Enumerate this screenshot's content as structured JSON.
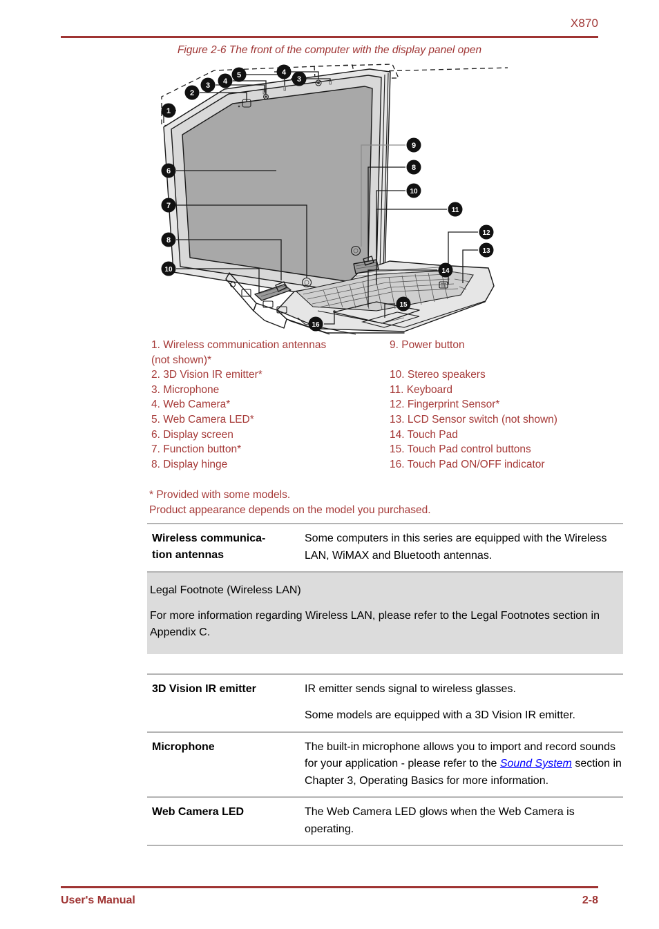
{
  "header": {
    "title": "X870"
  },
  "figure": {
    "caption": "Figure 2-6 The front of the computer with the display panel open",
    "callouts": [
      "1",
      "2",
      "3",
      "4",
      "5",
      "6",
      "7",
      "8",
      "9",
      "10",
      "11",
      "12",
      "13",
      "14",
      "15",
      "16"
    ]
  },
  "legend": {
    "left": [
      "1. Wireless communication antennas\n(not shown)*",
      "2. 3D Vision IR emitter*",
      "3. Microphone",
      "4. Web Camera*",
      "5. Web Camera LED*",
      "6. Display screen",
      "7. Function button*",
      "8. Display hinge"
    ],
    "right": [
      "9. Power button",
      "10. Stereo speakers",
      "11. Keyboard",
      "12. Fingerprint Sensor*",
      "13. LCD Sensor switch (not shown)",
      "14. Touch Pad",
      "15. Touch Pad control buttons",
      "16. Touch Pad ON/OFF indicator"
    ]
  },
  "notes": {
    "line1": "* Provided with some models.",
    "line2": "Product appearance depends on the model you purchased."
  },
  "definitions": [
    {
      "term": "Wireless communica-\ntion antennas",
      "paragraphs": [
        "Some computers in this series are equipped with the Wireless LAN, WiMAX and Bluetooth antennas."
      ]
    },
    {
      "term": "3D Vision IR emitter",
      "paragraphs": [
        "IR emitter sends signal to wireless glasses.",
        "Some models are equipped with a 3D Vision IR emitter."
      ]
    },
    {
      "term": "Microphone",
      "paragraphs": [
        "The built-in microphone allows you to import and record sounds for your application - please refer to the Sound System section in Chapter 3, Operating Basics for more information."
      ],
      "microphone_parts": {
        "before": "The built-in microphone allows you to import and record sounds for your application - please refer to the ",
        "link": "Sound System",
        "after": " section in Chapter 3, Operating Basics for more information."
      }
    },
    {
      "term": "Web Camera LED",
      "paragraphs": [
        "The Web Camera LED glows when the Web Camera is operating."
      ]
    }
  ],
  "legal_footnote": {
    "title": "Legal Footnote (Wireless LAN)",
    "body": "For more information regarding Wireless LAN, please refer to the Legal Footnotes section in Appendix C."
  },
  "footer": {
    "left": "User's Manual",
    "right": "2-8"
  },
  "colors": {
    "accent_red": "#9f3433",
    "legend_red": "#a63a38",
    "link_blue": "#0000ff",
    "rule_gray": "#b3b3b3",
    "callout_box_gray": "#dcdcdc"
  }
}
